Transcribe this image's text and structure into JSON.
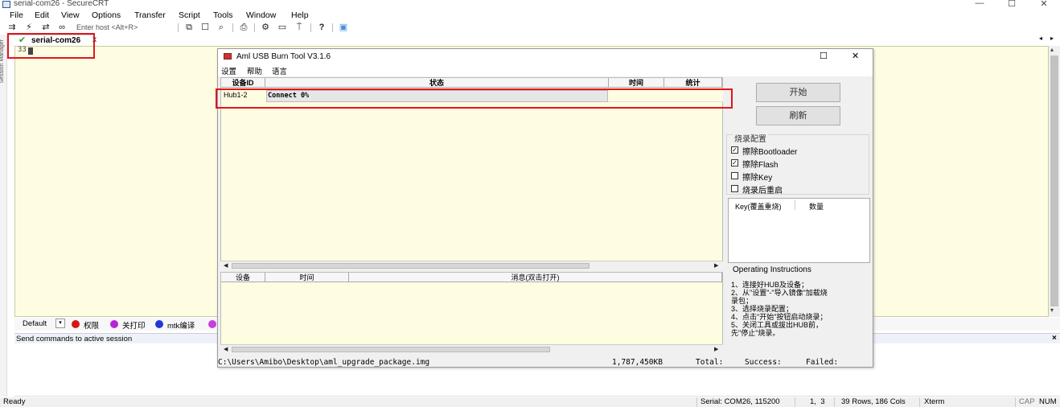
{
  "window": {
    "title": "serial-com26 - SecureCRT",
    "controls": {
      "minimize": "—",
      "maximize": "☐",
      "close": "✕"
    }
  },
  "menubar": [
    "File",
    "Edit",
    "View",
    "Options",
    "Transfer",
    "Script",
    "Tools",
    "Window",
    "Help"
  ],
  "toolbar": {
    "host_placeholder": "Enter host <Alt+R>",
    "icons": [
      "connect-icon",
      "quick-connect-icon",
      "reconnect-icon",
      "disconnect-icon",
      "copy-icon",
      "paste-icon",
      "find-icon",
      "print-icon",
      "settings-icon",
      "keymap-icon",
      "sftp-icon",
      "help-icon",
      "screen-icon"
    ]
  },
  "tabs": [
    {
      "label": "serial-com26",
      "close": "x",
      "status": "connected"
    }
  ],
  "sidebar": {
    "label": "Session Manager"
  },
  "terminal": {
    "text": "33"
  },
  "buttonbar": {
    "combo": "Default",
    "buttons": [
      {
        "label": "权限",
        "color": "#d41616"
      },
      {
        "label": "关打印",
        "color": "#b625d4"
      },
      {
        "label": "mtk编译",
        "color": "#1f38d6"
      }
    ]
  },
  "command_window": {
    "title": "Send commands to active session",
    "close": "×"
  },
  "statusbar": {
    "ready": "Ready",
    "serial": "Serial: COM26, 115200",
    "position": "1,  3",
    "size": "39 Rows, 186 Cols",
    "term": "Xterm",
    "cap": "CAP",
    "num": "NUM"
  },
  "dialog": {
    "title": "Aml USB Burn Tool V3.1.6",
    "menu": [
      "设置",
      "帮助",
      "语言"
    ],
    "grid": {
      "headers": [
        "设备ID",
        "状态",
        "时间",
        "统计"
      ],
      "rows": [
        {
          "device": "Hub1-2",
          "status": "Connect 0%",
          "time": "",
          "stats": ""
        }
      ]
    },
    "messages": {
      "headers": [
        "设备",
        "时间",
        "消息(双击打开)"
      ]
    },
    "path": "C:\\Users\\Amibo\\Desktop\\aml_upgrade_package.img",
    "size": "1,787,450KB",
    "total": "Total:",
    "success": "Success:",
    "failed": "Failed:",
    "start_button": "开始",
    "refresh_button": "刷新",
    "config": {
      "title": "烧录配置",
      "options": [
        {
          "label": "擦除Bootloader",
          "checked": true
        },
        {
          "label": "擦除Flash",
          "checked": true
        },
        {
          "label": "擦除Key",
          "checked": false
        },
        {
          "label": "烧录后重启",
          "checked": false
        }
      ]
    },
    "key_table": {
      "headers": [
        "Key(覆盖重烧)",
        "数量"
      ]
    },
    "instructions": {
      "title": "Operating Instructions",
      "lines": [
        "1、连接好HUB及设备；",
        "2、从\"设置\"-\"导入镜像\"加载烧",
        "录包；",
        "3、选择烧录配置；",
        "4、点击\"开始\"按钮启动烧录；",
        "5、关闭工具或拔出HUB前，",
        "先\"停止\"烧录。"
      ]
    }
  },
  "colors": {
    "terminal_bg": "#fffde1",
    "highlight": "#e0161d",
    "connected": "#2a9d2a"
  }
}
